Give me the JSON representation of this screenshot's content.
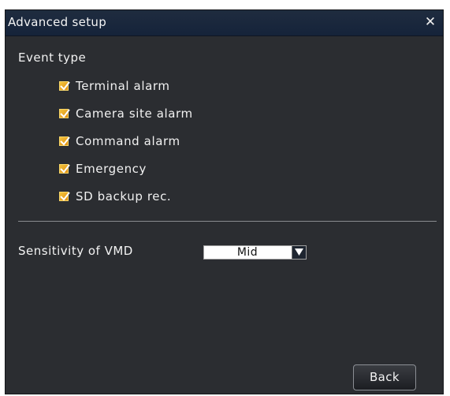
{
  "dialog": {
    "title": "Advanced setup",
    "close_icon": "close-icon",
    "close_symbol": "✕"
  },
  "event_type": {
    "label": "Event type",
    "items": [
      {
        "label": "Terminal alarm",
        "checked": true
      },
      {
        "label": "Camera site alarm",
        "checked": true
      },
      {
        "label": "Command alarm",
        "checked": true
      },
      {
        "label": "Emergency",
        "checked": true
      },
      {
        "label": "SD backup rec.",
        "checked": true
      }
    ]
  },
  "vmd": {
    "label": "Sensitivity of VMD",
    "selected": "Mid",
    "dropdown_icon": "chevron-down-icon"
  },
  "footer": {
    "back_label": "Back"
  },
  "colors": {
    "dialog_bg": "#2b2d31",
    "titlebar_bg": "#1a2740",
    "checkbox": "#f0b030",
    "text": "#f2f2f2"
  }
}
